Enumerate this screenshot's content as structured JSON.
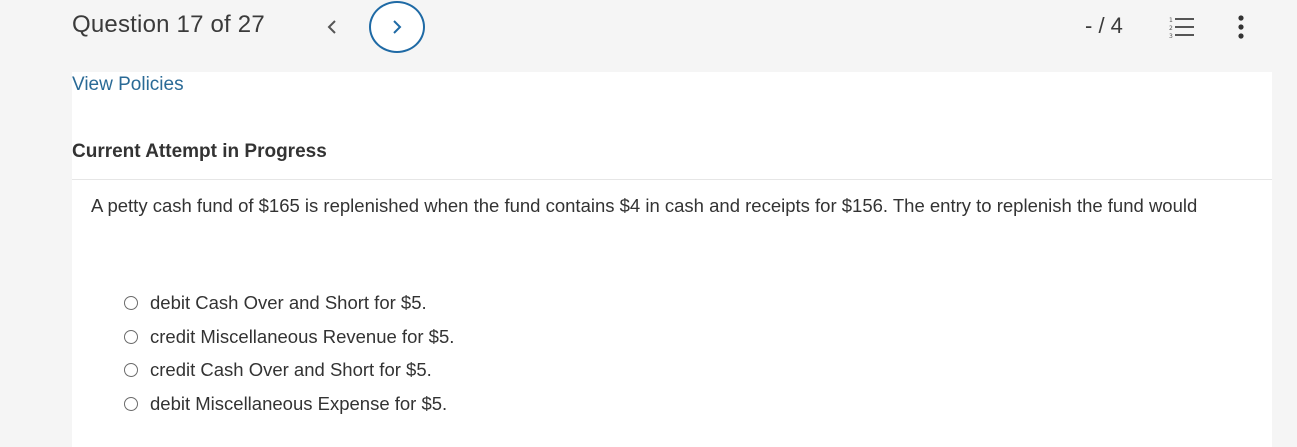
{
  "header": {
    "question_counter": "Question 17 of 27",
    "score": "- / 4",
    "prev_icon": "chevron-left-icon",
    "next_icon": "chevron-right-icon",
    "list_icon": "numbered-list-icon",
    "more_icon": "more-vertical-icon"
  },
  "links": {
    "view_policies": "View Policies"
  },
  "section": {
    "attempt_title": "Current Attempt in Progress"
  },
  "question": {
    "text": "A petty cash fund of $165 is replenished when the fund contains $4 in cash and receipts for $156. The entry to replenish the fund would"
  },
  "options": [
    {
      "label": "debit Cash Over and Short for $5."
    },
    {
      "label": "credit Miscellaneous Revenue for $5."
    },
    {
      "label": "credit Cash Over and Short for $5."
    },
    {
      "label": "debit Miscellaneous Expense for $5."
    }
  ],
  "colors": {
    "accent": "#1f6aa5",
    "link": "#2a6a96",
    "background": "#f5f5f5",
    "card": "#ffffff"
  }
}
